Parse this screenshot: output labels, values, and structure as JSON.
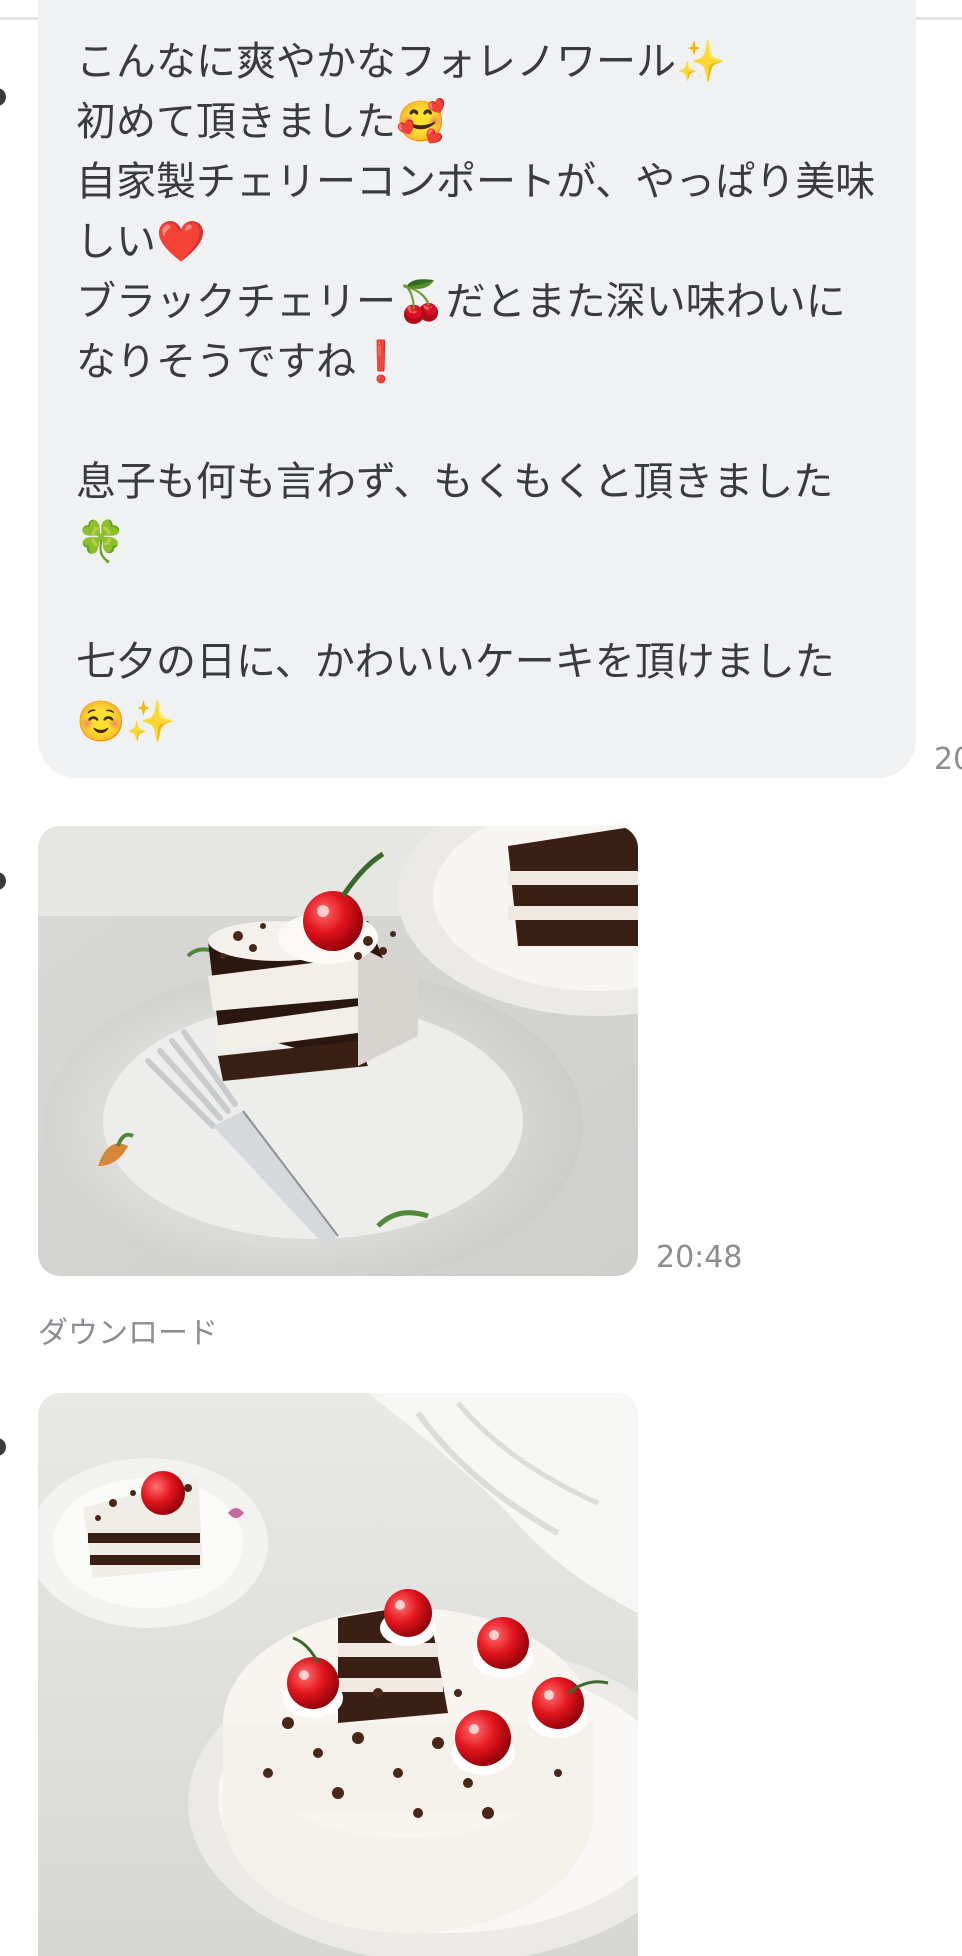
{
  "message": {
    "text": "こんなに爽やかなフォレノワール✨\n初めて頂きました🥰\n自家製チェリーコンポートが、やっぱり美味しい❤️\nブラックチェリー🍒だとまた深い味わいになりそうですね❗️\n\n息子も何も言わず、もくもくと頂きました🍀\n\n七夕の日に、かわいいケーキを頂けました☺️✨",
    "time_partial": "20"
  },
  "photo_1": {
    "time": "20:48",
    "download_label": "ダウンロード"
  },
  "colors": {
    "bubble_bg": "#f0f1f3",
    "text": "#3a3b3f",
    "meta_text": "#8b8d92"
  }
}
